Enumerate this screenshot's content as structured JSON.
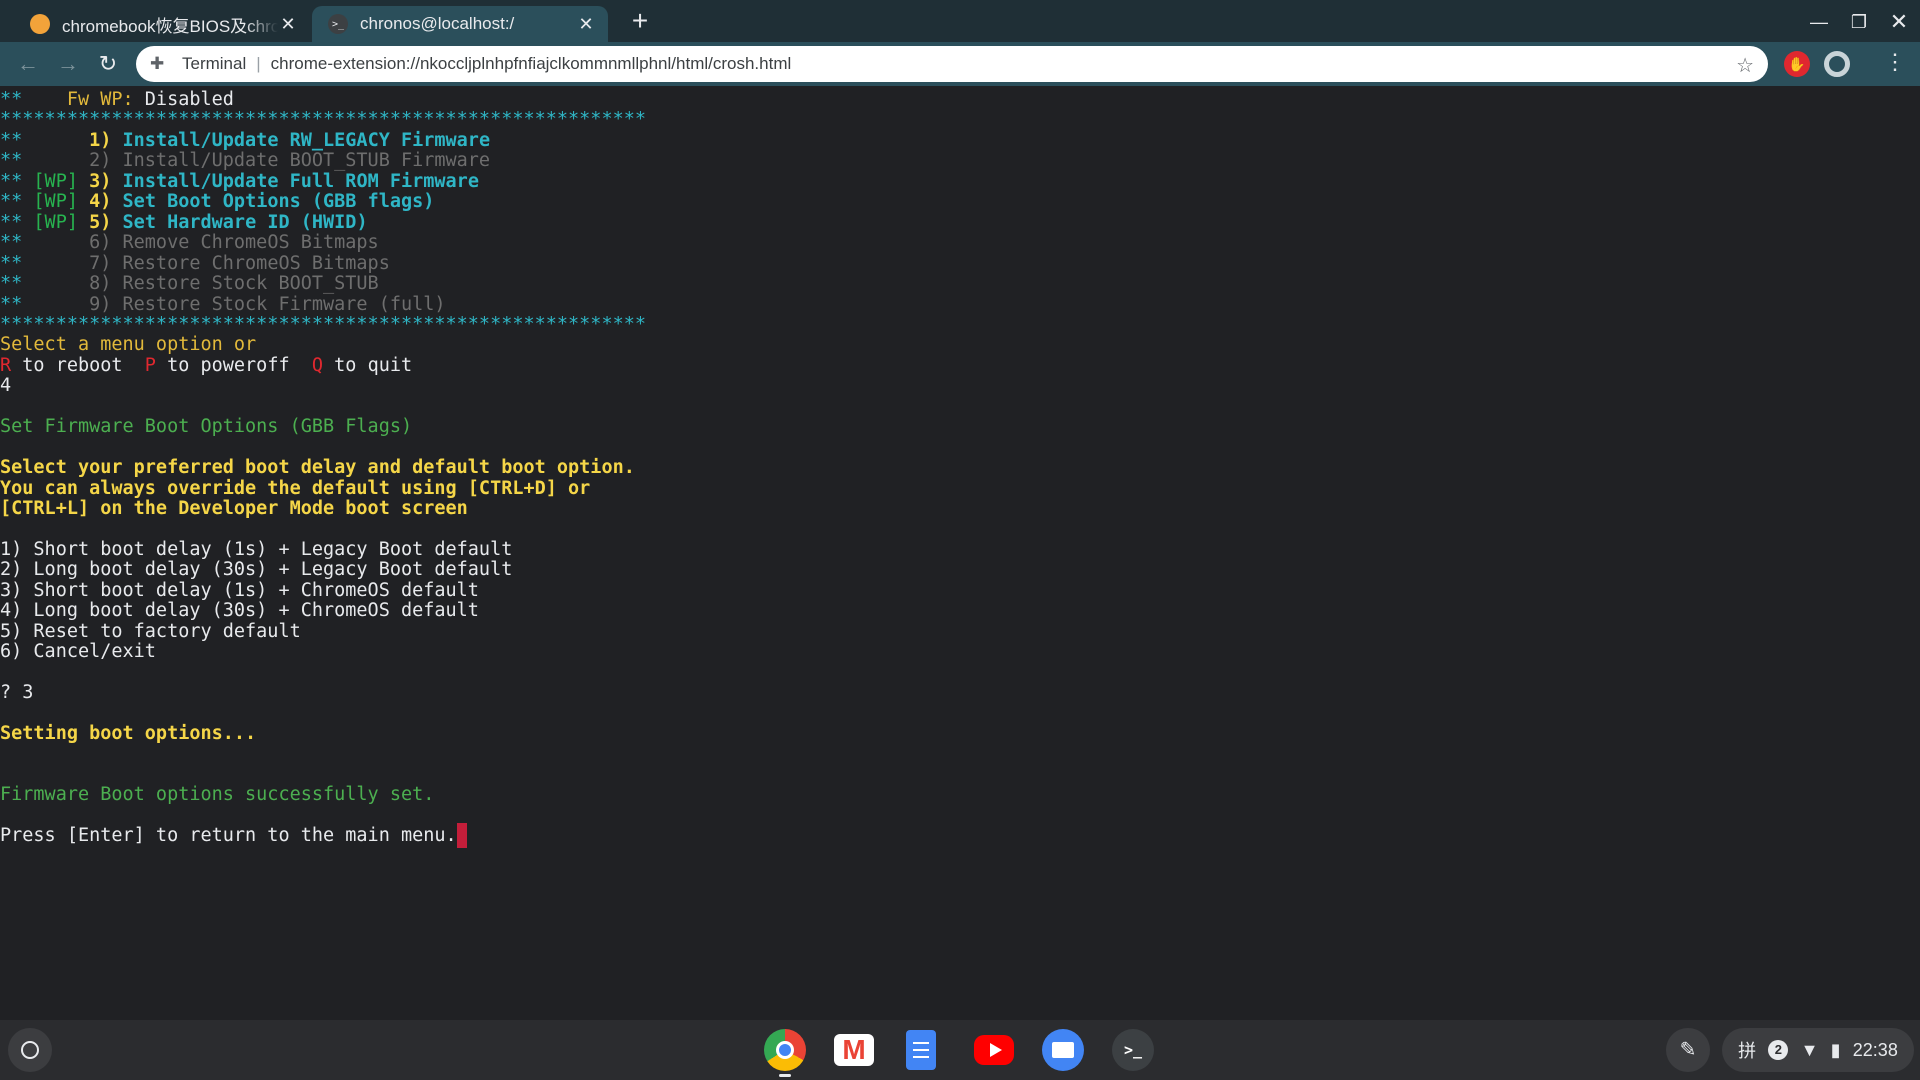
{
  "browser": {
    "tabs": [
      {
        "title": "chromebook恢复BIOS及chrom",
        "close": "✕"
      },
      {
        "title": "chronos@localhost:/",
        "close": "✕"
      }
    ],
    "new_tab": "+",
    "window_controls": {
      "minimize": "—",
      "maximize": "❐",
      "close": "✕"
    },
    "omnibox": {
      "chip": "Terminal",
      "separator": "|",
      "url": "chrome-extension://nkoccljplnhpfnfiajclkommnmllphnl/html/crosh.html"
    }
  },
  "terminal": {
    "lines": [
      [
        {
          "t": "**    ",
          "c": "cyan"
        },
        {
          "t": "Fw WP: ",
          "c": "yellow"
        },
        {
          "t": "Disabled",
          "c": "white"
        }
      ],
      [
        {
          "t": "**********************************************************",
          "c": "cyan"
        }
      ],
      [
        {
          "t": "**      ",
          "c": "cyan"
        },
        {
          "t": "1) ",
          "c": "yellow-b"
        },
        {
          "t": "Install/Update RW_LEGACY Firmware",
          "c": "cyan-b"
        }
      ],
      [
        {
          "t": "**      ",
          "c": "cyan"
        },
        {
          "t": "2) Install/Update BOOT_STUB Firmware",
          "c": "gray"
        }
      ],
      [
        {
          "t": "** ",
          "c": "cyan"
        },
        {
          "t": "[WP]",
          "c": "green"
        },
        {
          "t": " 3) ",
          "c": "yellow-b"
        },
        {
          "t": "Install/Update Full ROM Firmware",
          "c": "cyan-b"
        }
      ],
      [
        {
          "t": "** ",
          "c": "cyan"
        },
        {
          "t": "[WP]",
          "c": "green"
        },
        {
          "t": " 4) ",
          "c": "yellow-b"
        },
        {
          "t": "Set Boot Options (GBB flags)",
          "c": "cyan-b"
        }
      ],
      [
        {
          "t": "** ",
          "c": "cyan"
        },
        {
          "t": "[WP]",
          "c": "green"
        },
        {
          "t": " 5) ",
          "c": "yellow-b"
        },
        {
          "t": "Set Hardware ID (HWID)",
          "c": "cyan-b"
        }
      ],
      [
        {
          "t": "**      ",
          "c": "cyan"
        },
        {
          "t": "6) Remove ChromeOS Bitmaps",
          "c": "gray"
        }
      ],
      [
        {
          "t": "**      ",
          "c": "cyan"
        },
        {
          "t": "7) Restore ChromeOS Bitmaps",
          "c": "gray"
        }
      ],
      [
        {
          "t": "**      ",
          "c": "cyan"
        },
        {
          "t": "8) Restore Stock BOOT_STUB",
          "c": "gray"
        }
      ],
      [
        {
          "t": "**      ",
          "c": "cyan"
        },
        {
          "t": "9) Restore Stock Firmware (full)",
          "c": "gray"
        }
      ],
      [
        {
          "t": "**********************************************************",
          "c": "cyan"
        }
      ],
      [
        {
          "t": "Select a menu option or",
          "c": "yellow"
        }
      ],
      [
        {
          "t": "R",
          "c": "red"
        },
        {
          "t": " to reboot  ",
          "c": "white"
        },
        {
          "t": "P",
          "c": "red"
        },
        {
          "t": " to poweroff  ",
          "c": "white"
        },
        {
          "t": "Q",
          "c": "red"
        },
        {
          "t": " to quit",
          "c": "white"
        }
      ],
      [
        {
          "t": "4",
          "c": "white"
        }
      ],
      [],
      [
        {
          "t": "Set Firmware Boot Options (GBB Flags)",
          "c": "green2"
        }
      ],
      [],
      [
        {
          "t": "Select your preferred boot delay and default boot option.",
          "c": "yellow-b"
        }
      ],
      [
        {
          "t": "You can always override the default using [CTRL+D] or",
          "c": "yellow-b"
        }
      ],
      [
        {
          "t": "[CTRL+L] on the Developer Mode boot screen",
          "c": "yellow-b"
        }
      ],
      [],
      [
        {
          "t": "1) Short boot delay (1s) + Legacy Boot default",
          "c": "white"
        }
      ],
      [
        {
          "t": "2) Long boot delay (30s) + Legacy Boot default",
          "c": "white"
        }
      ],
      [
        {
          "t": "3) Short boot delay (1s) + ChromeOS default",
          "c": "white"
        }
      ],
      [
        {
          "t": "4) Long boot delay (30s) + ChromeOS default",
          "c": "white"
        }
      ],
      [
        {
          "t": "5) Reset to factory default",
          "c": "white"
        }
      ],
      [
        {
          "t": "6) Cancel/exit",
          "c": "white"
        }
      ],
      [],
      [
        {
          "t": "? 3",
          "c": "white"
        }
      ],
      [],
      [
        {
          "t": "Setting boot options...",
          "c": "yellow-b"
        }
      ],
      [],
      [],
      [
        {
          "t": "Firmware Boot options successfully set.",
          "c": "green2"
        }
      ],
      [],
      [
        {
          "t": "Press [Enter] to return to the main menu.",
          "c": "white"
        }
      ]
    ]
  },
  "shelf": {
    "apps": [
      "chrome-icon",
      "gmail-icon",
      "docs-icon",
      "youtube-icon",
      "files-icon",
      "terminal-icon"
    ],
    "terminal_glyph": ">_",
    "tray": {
      "ime": "拼",
      "notifications": "2",
      "time": "22:38"
    }
  }
}
